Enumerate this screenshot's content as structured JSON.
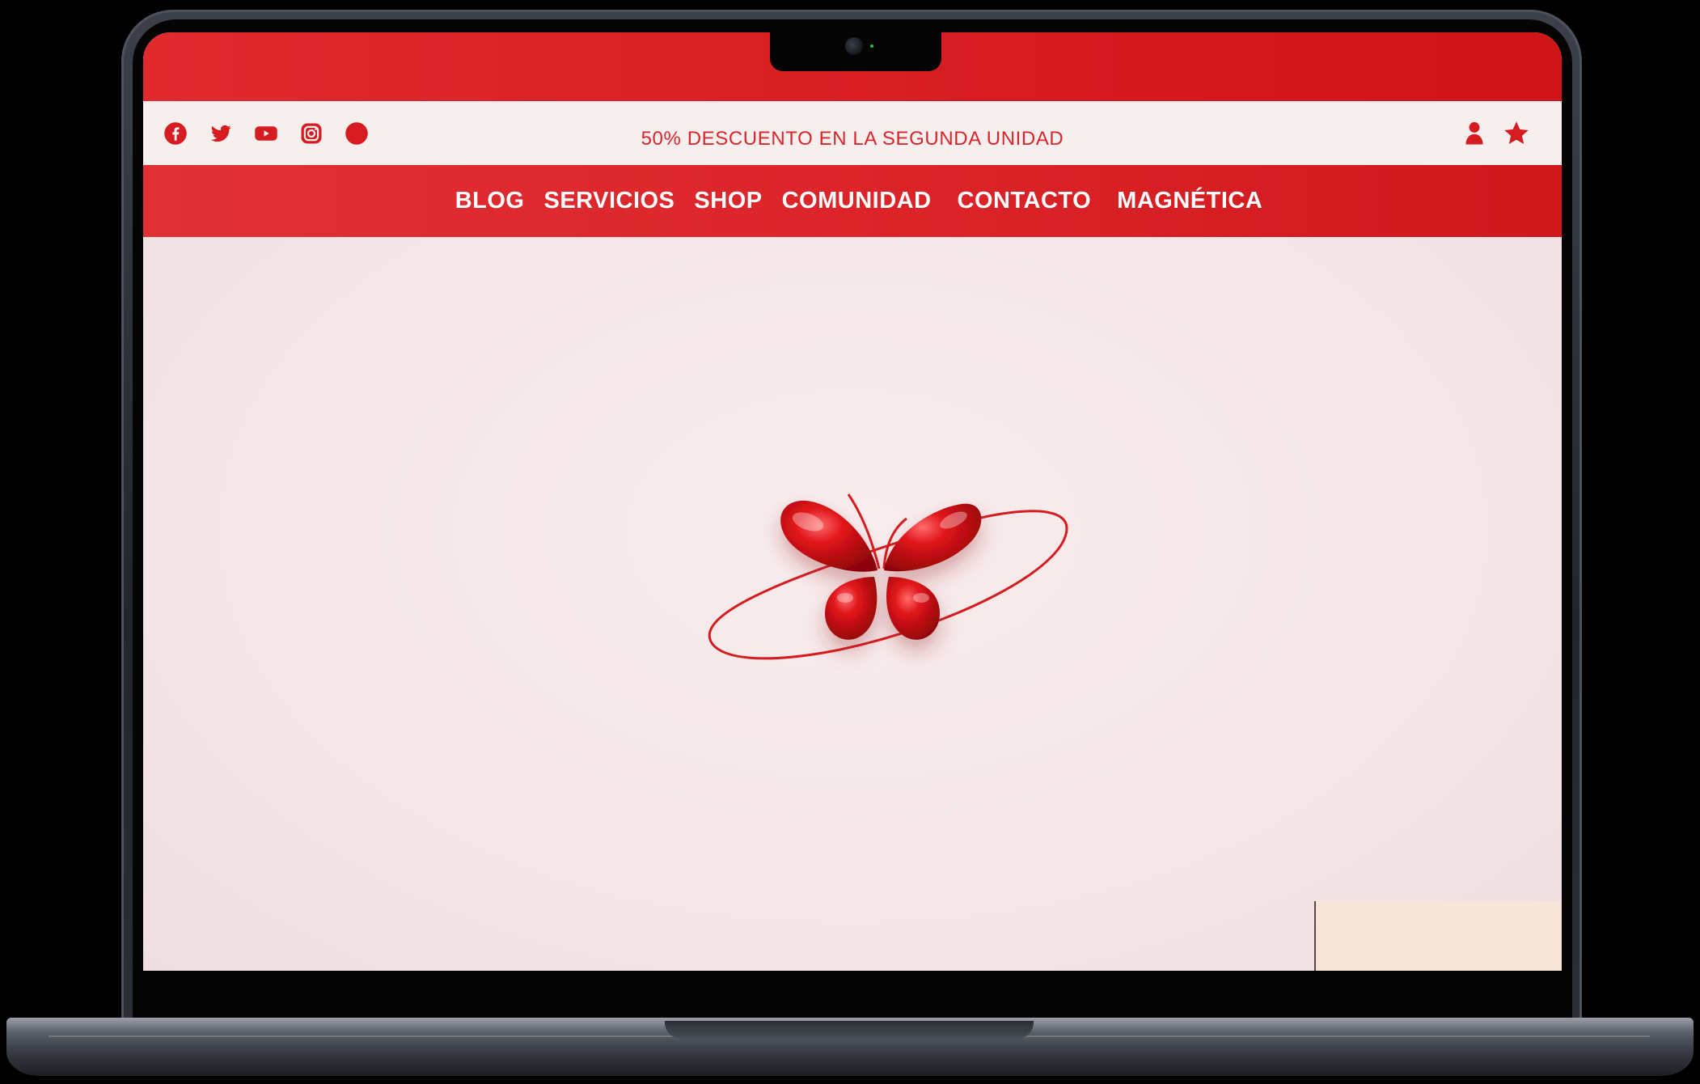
{
  "device": {
    "name": "laptop-mockup"
  },
  "site": {
    "promo_text": "50% DESCUENTO EN LA SEGUNDA UNIDAD",
    "brand_color": "#d61c21",
    "background_color": "#f3e6e7",
    "social_icons": [
      {
        "name": "facebook-icon"
      },
      {
        "name": "twitter-icon"
      },
      {
        "name": "youtube-icon"
      },
      {
        "name": "instagram-icon"
      },
      {
        "name": "circle-icon"
      }
    ],
    "account_icons": [
      {
        "name": "user-icon"
      },
      {
        "name": "star-icon"
      }
    ],
    "nav": {
      "items": [
        {
          "label": "BLOG"
        },
        {
          "label": "SERVICIOS"
        },
        {
          "label": "SHOP"
        },
        {
          "label": "COMUNIDAD"
        },
        {
          "label": "CONTACTO"
        },
        {
          "label": "MAGNÉTICA"
        }
      ]
    },
    "hero": {
      "image": "red-butterfly-logo"
    }
  }
}
